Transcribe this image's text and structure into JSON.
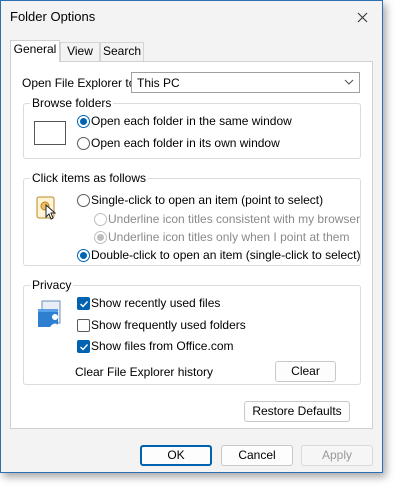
{
  "window": {
    "title": "Folder Options"
  },
  "tabs": [
    {
      "label": "General",
      "active": true
    },
    {
      "label": "View",
      "active": false
    },
    {
      "label": "Search",
      "active": false
    }
  ],
  "open_explorer": {
    "label": "Open File Explorer to:",
    "value": "This PC"
  },
  "browse_folders": {
    "title": "Browse folders",
    "options": [
      {
        "label": "Open each folder in the same window",
        "selected": true
      },
      {
        "label": "Open each folder in its own window",
        "selected": false
      }
    ]
  },
  "click_items": {
    "title": "Click items as follows",
    "options": [
      {
        "label": "Single-click to open an item (point to select)",
        "selected": false,
        "enabled": true
      },
      {
        "label": "Underline icon titles consistent with my browser",
        "selected": false,
        "enabled": false
      },
      {
        "label": "Underline icon titles only when I point at them",
        "selected": true,
        "enabled": false
      },
      {
        "label": "Double-click to open an item (single-click to select)",
        "selected": true,
        "enabled": true
      }
    ]
  },
  "privacy": {
    "title": "Privacy",
    "options": [
      {
        "label": "Show recently used files",
        "checked": true
      },
      {
        "label": "Show frequently used folders",
        "checked": false
      },
      {
        "label": "Show files from Office.com",
        "checked": true
      }
    ],
    "clear_label": "Clear File Explorer history",
    "clear_button": "Clear"
  },
  "restore_defaults": "Restore Defaults",
  "buttons": {
    "ok": "OK",
    "cancel": "Cancel",
    "apply": "Apply"
  },
  "colors": {
    "accent": "#0063b1",
    "window_border": "#2d6fb3"
  }
}
